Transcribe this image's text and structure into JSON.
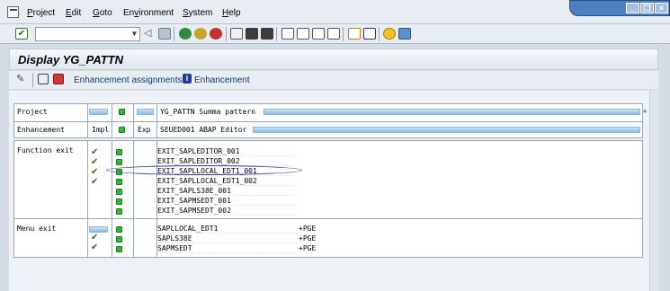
{
  "menubar": {
    "items": [
      "Project",
      "Edit",
      "Goto",
      "Environment",
      "System",
      "Help"
    ],
    "underline": [
      "P",
      "E",
      "G",
      "v",
      "S",
      "H"
    ]
  },
  "toolbar": {
    "command_value": ""
  },
  "title": "Display YG_PATTN",
  "app_toolbar": {
    "enh_assignments": "Enhancement assignments",
    "enhancement": "Enhancement"
  },
  "project_row": {
    "label": "Project",
    "value": "YG_PATTN Summa pattern"
  },
  "enhancement_row": {
    "label": "Enhancement",
    "impl": "Impl",
    "exp": "Exp",
    "value": "SEUED001 ABAP Editor"
  },
  "function_exit": {
    "label": "Function exit",
    "exits": [
      "EXIT_SAPLEDITOR_001",
      "EXIT_SAPLEDITOR_002",
      "EXIT_SAPLLOCAL_EDT1_001",
      "EXIT_SAPLLOCAL_EDT1_002",
      "EXIT_SAPLS38E_001",
      "EXIT_SAPMSEDT_001",
      "EXIT_SAPMSEDT_002"
    ],
    "checked_count": 4
  },
  "menu_exit": {
    "label": "Menu exit",
    "exits": [
      {
        "program": "SAPLLOCAL_EDT1",
        "code": "+PGE"
      },
      {
        "program": "SAPLS38E",
        "code": "+PGE"
      },
      {
        "program": "SAPMSEDT",
        "code": "+PGE"
      }
    ]
  },
  "colors": {
    "link": "#14377a",
    "active_green": "#2db82d",
    "header_blue": "#8bbbe6"
  }
}
